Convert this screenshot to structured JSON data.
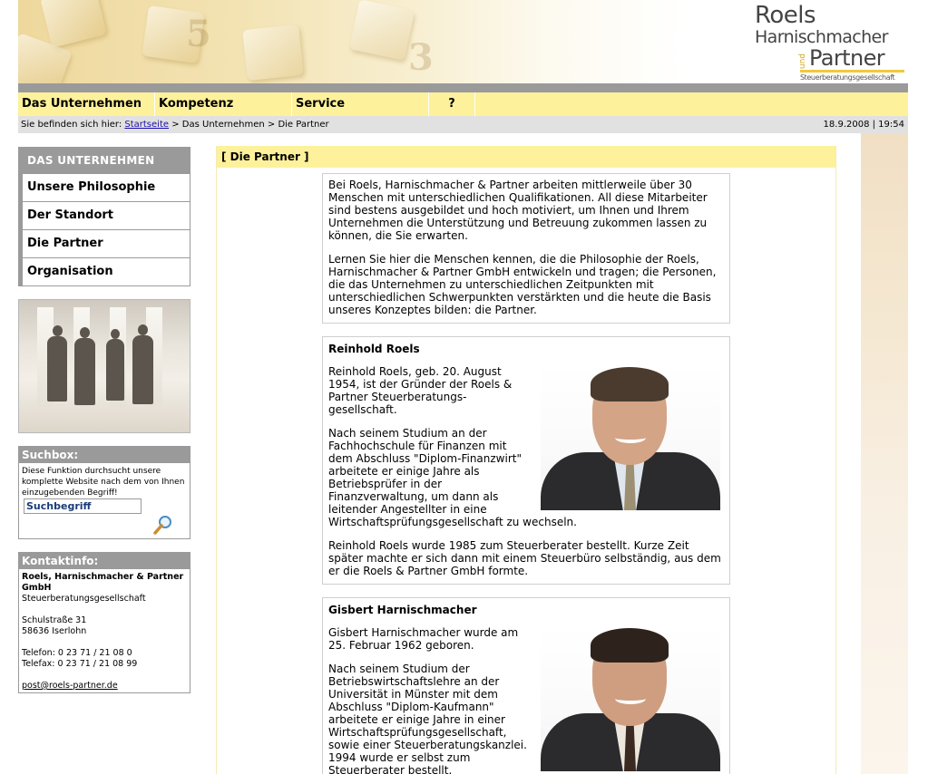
{
  "nav": {
    "items": [
      "Das Unternehmen",
      "Kompetenz",
      "Service",
      "?"
    ]
  },
  "breadcrumb": {
    "prefix": "Sie befinden sich hier:",
    "home": "Startseite",
    "rest": "> Das Unternehmen > Die Partner",
    "datetime": "18.9.2008 | 19:54"
  },
  "sidebar": {
    "heading": "DAS UNTERNEHMEN",
    "items": [
      "Unsere Philosophie",
      "Der Standort",
      "Die Partner",
      "Organisation"
    ]
  },
  "search": {
    "title": "Suchbox:",
    "description": "Diese Funktion durchsucht unsere komplette Website nach dem von Ihnen einzugebenden Begriff!",
    "value": "Suchbegriff"
  },
  "contact": {
    "title": "Kontaktinfo:",
    "company": "Roels, Harnischmacher & Partner GmbH",
    "company_type": "Steuerberatungsgesellschaft",
    "street": "Schulstraße 31",
    "city": "58636 Iserlohn",
    "phone": "Telefon: 0 23 71 / 21 08 0",
    "fax": "Telefax: 0 23 71 / 21 08 99",
    "email": "post@roels-partner.de"
  },
  "logo": {
    "line1": "Roels",
    "line2": "Harnischmacher",
    "und": "und",
    "line3": "Partner",
    "subtitle": "Steuerberatungsgesellschaft"
  },
  "content": {
    "heading": "[ Die Partner ]",
    "intro": [
      "Bei Roels, Harnischmacher & Partner arbeiten mittlerweile über 30 Menschen mit unterschiedlichen Qualifikationen. All diese Mitarbeiter sind bestens ausgebildet und hoch motiviert, um Ihnen und Ihrem Unternehmen die Unterstützung und Betreuung zukommen lassen zu können, die Sie erwarten.",
      "Lernen Sie hier die Menschen kennen, die die Philosophie der Roels, Harnischmacher & Partner GmbH entwickeln und tragen; die Personen, die das Unternehmen zu unterschiedlichen Zeitpunkten mit unterschiedlichen Schwerpunkten verstärkten und die heute die Basis unseres Konzeptes bilden: die Partner."
    ],
    "partners": [
      {
        "name": "Reinhold Roels",
        "paragraphs": [
          "Reinhold Roels, geb. 20. August 1954, ist der Gründer der Roels & Partner Steuerberatungs-gesellschaft.",
          "Nach seinem Studium an der Fachhochschule für Finanzen mit dem Abschluss \"Diplom-Finanzwirt\" arbeitete er einige Jahre als Betriebsprüfer in der Finanzverwaltung, um dann als leitender Angestellter in eine Wirtschaftsprüfungsgesellschaft zu wechseln.",
          "Reinhold Roels wurde 1985 zum Steuerberater bestellt. Kurze Zeit später machte er sich dann mit einem Steuerbüro selbständig, aus dem er die Roels & Partner GmbH formte."
        ]
      },
      {
        "name": "Gisbert Harnischmacher",
        "paragraphs": [
          "Gisbert Harnischmacher wurde am 25. Februar 1962 geboren.",
          "Nach seinem Studium der Betriebswirtschaftslehre an der Universität in Münster mit dem Abschluss \"Diplom-Kaufmann\" arbeitete er einige Jahre in einer Wirtschaftsprüfungsgesellschaft, sowie einer Steuerberatungskanzlei. 1994 wurde er selbst zum Steuerberater bestellt."
        ]
      }
    ]
  },
  "colors": {
    "nav_bg": "#fdf19b",
    "grey": "#9a9a9a",
    "logo_accent": "#f0c83c"
  }
}
